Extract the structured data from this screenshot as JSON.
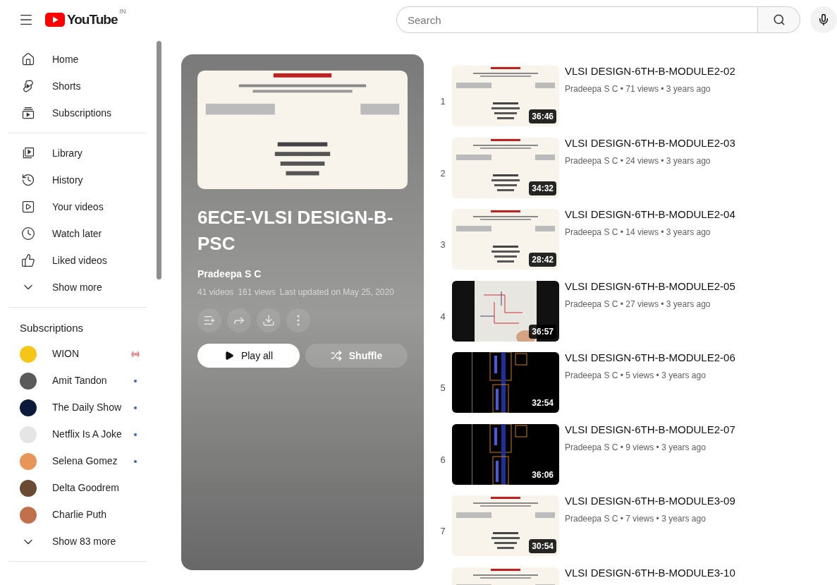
{
  "header": {
    "logo": "YouTube",
    "country": "IN",
    "search": {
      "placeholder": "Search"
    }
  },
  "sidebar": {
    "primary": [
      {
        "label": "Home",
        "kind": "home"
      },
      {
        "label": "Shorts",
        "kind": "shorts"
      },
      {
        "label": "Subscriptions",
        "kind": "subscriptions"
      }
    ],
    "library": [
      {
        "label": "Library",
        "kind": "library"
      },
      {
        "label": "History",
        "kind": "history"
      },
      {
        "label": "Your videos",
        "kind": "videos"
      },
      {
        "label": "Watch later",
        "kind": "clock"
      },
      {
        "label": "Liked videos",
        "kind": "like"
      },
      {
        "label": "Show more",
        "kind": "expand"
      }
    ],
    "subscriptions_title": "Subscriptions",
    "subscriptions": [
      {
        "name": "WION",
        "kind": "live",
        "color": "#f5c518"
      },
      {
        "name": "Amit Tandon",
        "kind": "new",
        "color": "#5a5a5a"
      },
      {
        "name": "The Daily Show",
        "kind": "new",
        "color": "#0b1a3a"
      },
      {
        "name": "Netflix Is A Joke",
        "kind": "new",
        "color": "#e5e5e5"
      },
      {
        "name": "Selena Gomez",
        "kind": "new",
        "color": "#e8955a"
      },
      {
        "name": "Delta Goodrem",
        "kind": "plain",
        "color": "#6b4a33"
      },
      {
        "name": "Charlie Puth",
        "kind": "plain",
        "color": "#c0704a"
      }
    ],
    "show_more": "Show 83 more"
  },
  "playlist": {
    "title": "6ECE-VLSI DESIGN-B-PSC",
    "channel": "Pradeepa S C",
    "stats": [
      "41 videos",
      "161 views",
      "Last updated on May 25, 2020"
    ],
    "play_all": "Play all",
    "shuffle": "Shuffle"
  },
  "videos": [
    {
      "index": "1",
      "title": "VLSI DESIGN-6TH-B-MODULE2-02",
      "meta": "Pradeepa S C • 71 views • 3 years ago",
      "duration": "36:46"
    },
    {
      "index": "2",
      "title": "VLSI DESIGN-6TH-B-MODULE2-03",
      "meta": "Pradeepa S C • 24 views • 3 years ago",
      "duration": "34:32"
    },
    {
      "index": "3",
      "title": "VLSI DESIGN-6TH-B-MODULE2-04",
      "meta": "Pradeepa S C • 14 views • 3 years ago",
      "duration": "28:42"
    },
    {
      "index": "4",
      "title": "VLSI DESIGN-6TH-B-MODULE2-05",
      "meta": "Pradeepa S C • 27 views • 3 years ago",
      "duration": "36:57"
    },
    {
      "index": "5",
      "title": "VLSI DESIGN-6TH-B-MODULE2-06",
      "meta": "Pradeepa S C • 5 views • 3 years ago",
      "duration": "32:54"
    },
    {
      "index": "6",
      "title": "VLSI DESIGN-6TH-B-MODULE2-07",
      "meta": "Pradeepa S C • 9 views • 3 years ago",
      "duration": "36:06"
    },
    {
      "index": "7",
      "title": "VLSI DESIGN-6TH-B-MODULE3-09",
      "meta": "Pradeepa S C • 7 views • 3 years ago",
      "duration": "30:54"
    },
    {
      "title": "VLSI DESIGN-6TH-B-MODULE3-10"
    }
  ]
}
